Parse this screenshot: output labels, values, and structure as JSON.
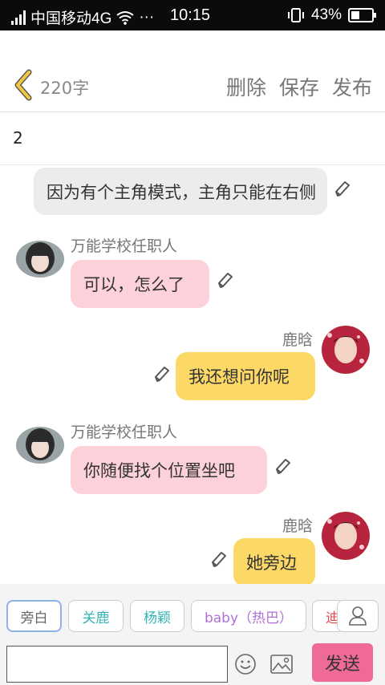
{
  "status_bar": {
    "carrier": "中国移动4G",
    "dots": "···",
    "time": "10:15",
    "battery": "43%",
    "battery_level": 0.43
  },
  "toolbar": {
    "char_count": "220字",
    "delete_label": "删除",
    "save_label": "保存",
    "publish_label": "发布"
  },
  "chapter": {
    "title": "2"
  },
  "messages": [
    {
      "side": "narration",
      "text": "因为有个主角模式，主角只能在右侧"
    },
    {
      "side": "left",
      "name": "万能学校任职人",
      "text": "可以，怎么了"
    },
    {
      "side": "right",
      "name": "鹿晗",
      "text": "我还想问你呢"
    },
    {
      "side": "left",
      "name": "万能学校任职人",
      "text": "你随便找个位置坐吧"
    },
    {
      "side": "right",
      "name": "鹿晗",
      "text": "她旁边"
    }
  ],
  "characters": [
    {
      "label": "旁白",
      "color": "#666666"
    },
    {
      "label": "关鹿",
      "color": "#33b5b5"
    },
    {
      "label": "杨颖",
      "color": "#33b5b5"
    },
    {
      "label": "baby（热巴）",
      "color": "#b070d8"
    },
    {
      "label": "迪",
      "color": "#e5484d"
    }
  ],
  "input": {
    "placeholder": "",
    "send_label": "发送"
  },
  "colors": {
    "send_button": "#ef6a94",
    "narration_bubble": "#ececec",
    "left_bubble": "#fcd1d9",
    "right_bubble": "#fcd866",
    "back_chevron": "#f2c640"
  }
}
